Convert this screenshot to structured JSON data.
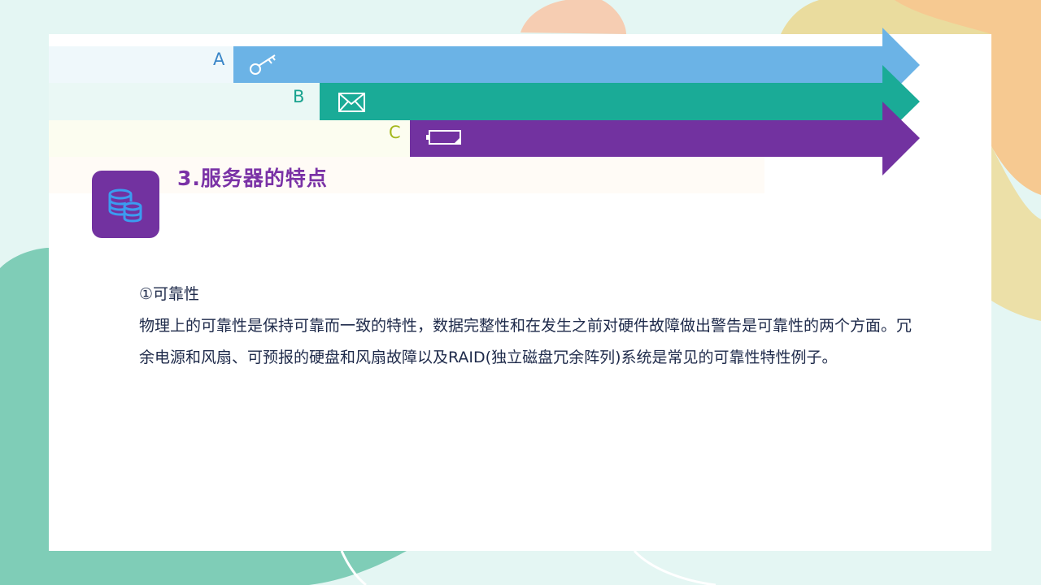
{
  "slide": {
    "title": "3.服务器的特点",
    "icon": "database-icon"
  },
  "arrows": [
    {
      "letter": "A",
      "icon": "key-icon",
      "color": "#6bb3e6",
      "letter_color": "#3a86c8"
    },
    {
      "letter": "B",
      "icon": "envelope-icon",
      "color": "#1aab97",
      "letter_color": "#1aa38f"
    },
    {
      "letter": "C",
      "icon": "battery-icon",
      "color": "#7232a0",
      "letter_color": "#a4b81c"
    }
  ],
  "content": {
    "heading": "①可靠性",
    "body": "物理上的可靠性是保持可靠而一致的特性，数据完整性和在发生之前对硬件故障做出警告是可靠性的两个方面。冗余电源和风扇、可预报的硬盘和风扇故障以及RAID(独立磁盘冗余阵列)系统是常见的可靠性特性例子。"
  }
}
